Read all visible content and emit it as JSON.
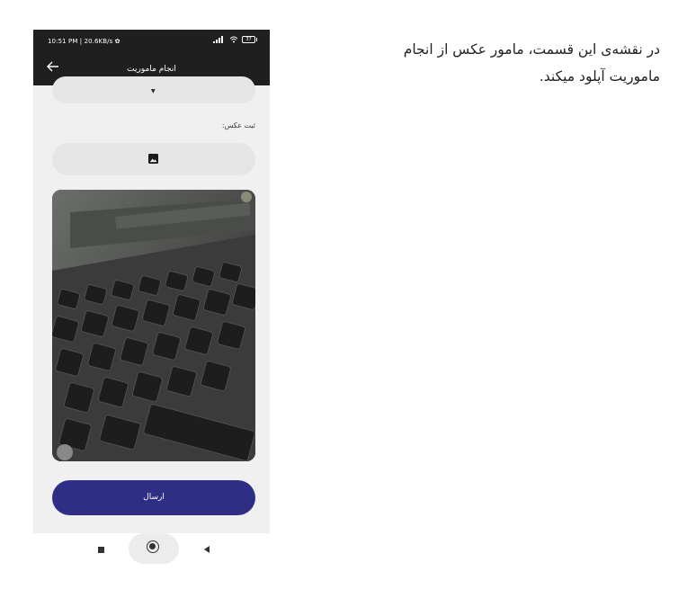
{
  "status_bar": {
    "left_text": "10:51 PM | 20.6KB/s ✿",
    "battery": "37"
  },
  "app_bar": {
    "title": "انجام ماموریت",
    "back_icon": "arrow-left-icon"
  },
  "form": {
    "photo_label": "ثبت عکس:",
    "photo_picker_icon": "image-icon",
    "photo_description": "uploaded photo of a laptop keyboard",
    "submit_label": "ارسال"
  },
  "nav_bar": {
    "recent_icon": "square-icon",
    "home_icon": "circle-home-icon",
    "back_icon": "triangle-back-icon"
  },
  "caption": "در نقشه‌ی این قسمت، مامور عکس از انجام ماموریت آپلود میکند.",
  "colors": {
    "appbar": "#1f1f1f",
    "background": "#f0f0f0",
    "field": "#e5e5e5",
    "primary_button": "#2e2e85"
  }
}
